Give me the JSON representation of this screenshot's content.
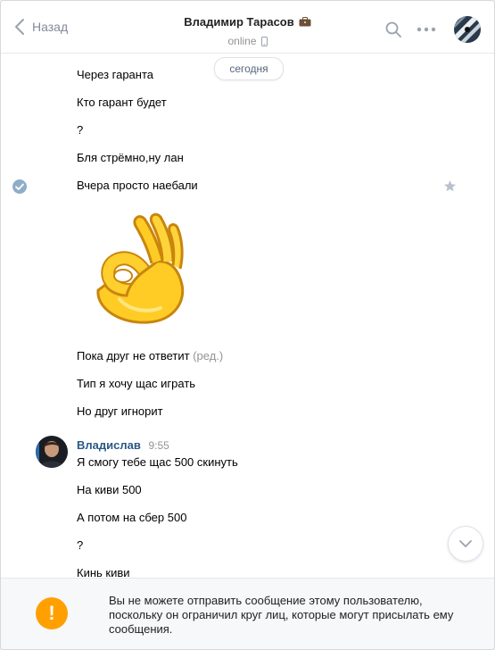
{
  "header": {
    "back_label": "Назад",
    "contact_name": "Владимир Тарасов",
    "status": "online",
    "icons": {
      "back": "chevron-left-icon",
      "badge": "briefcase-icon",
      "device": "phone-icon",
      "search": "search-icon",
      "more": "more-horizontal-icon"
    }
  },
  "date_divider": "сегодня",
  "messages": [
    {
      "text": "Через гаранта"
    },
    {
      "text": "Кто гарант будет"
    },
    {
      "text": "?"
    },
    {
      "text": "Бля стрёмно,ну лан"
    },
    {
      "text": "Вчера просто наебали"
    },
    {
      "text": "Пока друг не ответит",
      "edited": "(ред.)"
    },
    {
      "text": "Тип я хочу щас играть"
    },
    {
      "text": "Но друг игнорит"
    }
  ],
  "sticker": {
    "name": "ok-hand-sticker"
  },
  "author_block": {
    "name": "Владислав",
    "time": "9:55",
    "messages": [
      {
        "text": "Я смогу тебе щас 500 скинуть"
      },
      {
        "text": "На киви 500"
      },
      {
        "text": "А потом на сбер 500"
      },
      {
        "text": "?"
      },
      {
        "text": "Кинь киви"
      }
    ]
  },
  "footer": {
    "icon": "exclamation-icon",
    "notice": "Вы не можете отправить сообщение этому пользователю, поскольку он ограничил круг лиц, которые могут присылать ему сообщения."
  },
  "colors": {
    "accent_link": "#2a5885",
    "muted": "#828a99",
    "check": "#8fadc8",
    "warning": "#ffa000",
    "background": "#edeef0"
  }
}
